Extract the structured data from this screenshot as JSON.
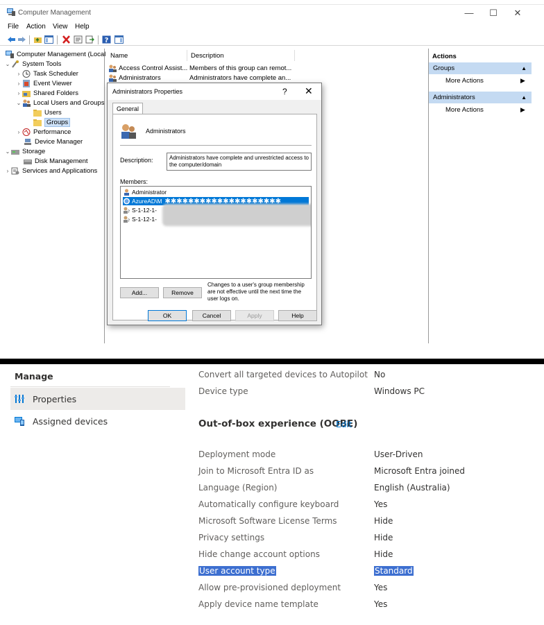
{
  "window": {
    "title": "Computer Management",
    "controls": {
      "minimize": "—",
      "maximize": "☐",
      "close": "✕"
    }
  },
  "menu": [
    "File",
    "Action",
    "View",
    "Help"
  ],
  "tree": {
    "root": "Computer Management (Local",
    "system_tools": "System Tools",
    "task_scheduler": "Task Scheduler",
    "event_viewer": "Event Viewer",
    "shared_folders": "Shared Folders",
    "local_users_groups": "Local Users and Groups",
    "users": "Users",
    "groups": "Groups",
    "performance": "Performance",
    "device_manager": "Device Manager",
    "storage": "Storage",
    "disk_management": "Disk Management",
    "services_apps": "Services and Applications"
  },
  "list": {
    "col_name": "Name",
    "col_description": "Description",
    "rows": [
      {
        "name": "Access Control Assist...",
        "description": "Members of this group can remot..."
      },
      {
        "name": "Administrators",
        "description": "Administrators have complete an..."
      }
    ]
  },
  "actions": {
    "header": "Actions",
    "section1": "Groups",
    "section2": "Administrators",
    "more": "More Actions"
  },
  "dialog": {
    "title": "Administrators Properties",
    "help_glyph": "?",
    "close_glyph": "✕",
    "tab": "General",
    "group_name": "Administrators",
    "description_label": "Description:",
    "description_value": "Administrators have complete and unrestricted access to the computer/domain",
    "members_label": "Members:",
    "members": [
      {
        "name": "Administrator",
        "masked": ""
      },
      {
        "name": "AzureAD\\M",
        "masked": "✱✱✱✱✱✱✱✱✱✱✱✱✱✱✱✱✱✱✱✱"
      },
      {
        "name": "S-1-12-1-",
        "masked": ""
      },
      {
        "name": "S-1-12-1-",
        "masked": ""
      }
    ],
    "add_button": "Add...",
    "remove_button": "Remove",
    "note": "Changes to a user's group membership are not effective until the next time the user logs on.",
    "ok_button": "OK",
    "cancel_button": "Cancel",
    "apply_button": "Apply",
    "help_button": "Help"
  },
  "intune": {
    "manage": "Manage",
    "nav": [
      {
        "label": "Properties",
        "active": true
      },
      {
        "label": "Assigned devices",
        "active": false
      }
    ],
    "top_props": [
      {
        "label": "Convert all targeted devices to Autopilot",
        "value": "No"
      },
      {
        "label": "Device type",
        "value": "Windows PC"
      }
    ],
    "oobe_title": "Out-of-box experience (OOBE)",
    "edit_link": "Edit",
    "oobe_props": [
      {
        "label": "Deployment mode",
        "value": "User-Driven"
      },
      {
        "label": "Join to Microsoft Entra ID as",
        "value": "Microsoft Entra joined"
      },
      {
        "label": "Language (Region)",
        "value": "English (Australia)"
      },
      {
        "label": "Automatically configure keyboard",
        "value": "Yes"
      },
      {
        "label": "Microsoft Software License Terms",
        "value": "Hide"
      },
      {
        "label": "Privacy settings",
        "value": "Hide"
      },
      {
        "label": "Hide change account options",
        "value": "Hide"
      },
      {
        "label": "User account type",
        "value": "Standard"
      },
      {
        "label": "Allow pre-provisioned deployment",
        "value": "Yes"
      },
      {
        "label": "Apply device name template",
        "value": "Yes"
      }
    ]
  }
}
